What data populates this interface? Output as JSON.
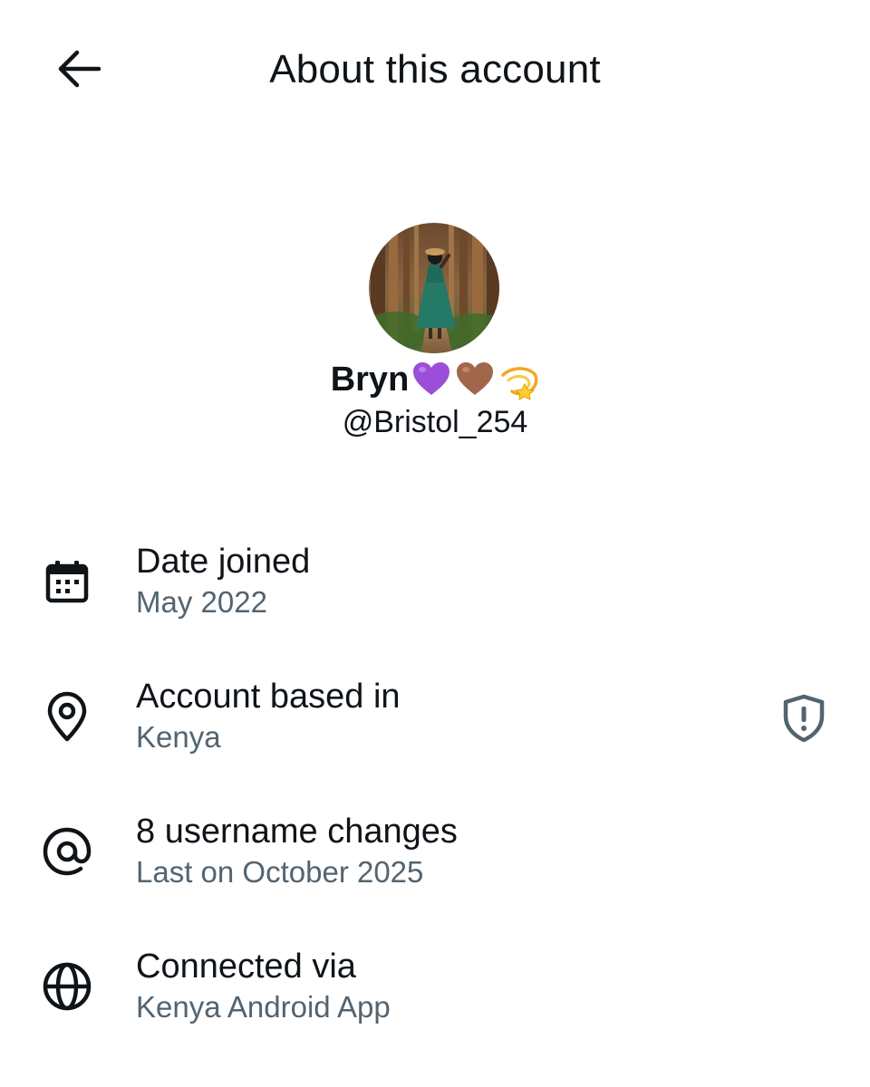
{
  "header": {
    "title": "About this account",
    "back_icon": "arrow-left-icon"
  },
  "profile": {
    "display_name": "Bryn",
    "name_emojis": [
      "purple-heart-emoji",
      "brown-heart-emoji",
      "dizzy-star-emoji"
    ],
    "handle": "@Bristol_254",
    "avatar": "profile-photo-forest"
  },
  "rows": [
    {
      "icon": "calendar-icon",
      "title": "Date joined",
      "subtitle": "May 2022"
    },
    {
      "icon": "location-pin-icon",
      "title": "Account based in",
      "subtitle": "Kenya",
      "action_icon": "shield-alert-icon"
    },
    {
      "icon": "at-sign-icon",
      "title": "8 username changes",
      "subtitle": "Last on October 2025"
    },
    {
      "icon": "globe-icon",
      "title": "Connected via",
      "subtitle": "Kenya Android App"
    }
  ],
  "colors": {
    "primary_text": "#0f1419",
    "secondary_text": "#536471",
    "background": "#ffffff"
  }
}
